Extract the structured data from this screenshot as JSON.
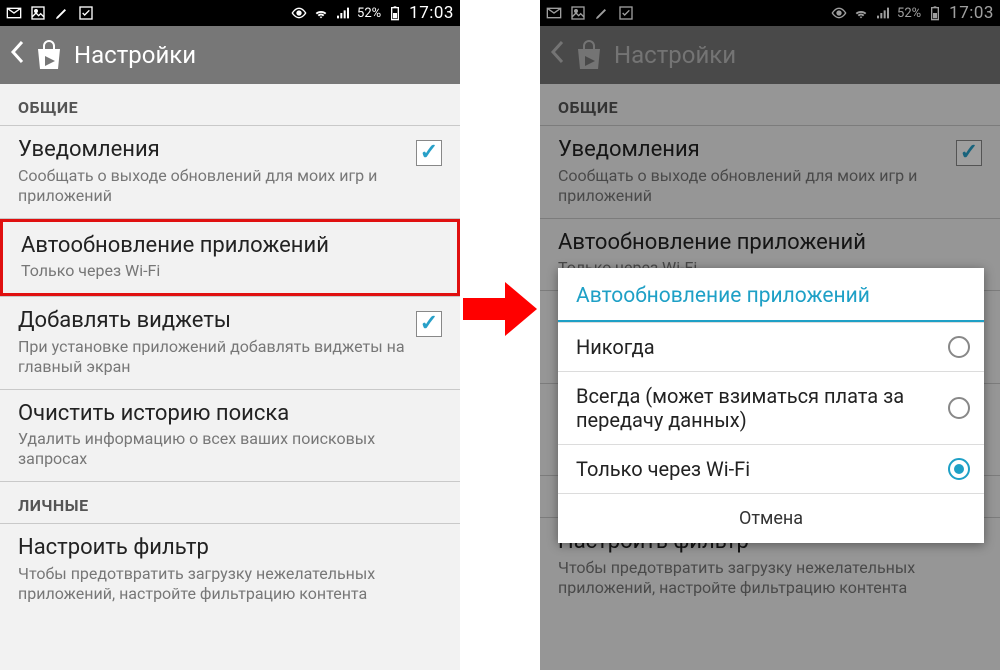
{
  "status": {
    "battery_percent": "52%",
    "time": "17:03"
  },
  "action_bar": {
    "title": "Настройки"
  },
  "sections": {
    "general": "ОБЩИЕ",
    "personal": "ЛИЧНЫЕ"
  },
  "settings": {
    "notifications": {
      "title": "Уведомления",
      "sub": "Сообщать о выходе обновлений для моих игр и приложений",
      "checked": true
    },
    "auto_update": {
      "title": "Автообновление приложений",
      "sub": "Только через Wi-Fi"
    },
    "add_widgets": {
      "title": "Добавлять виджеты",
      "sub": "При установке приложений добавлять виджеты на главный экран",
      "checked": true
    },
    "clear_history": {
      "title": "Очистить историю поиска",
      "sub": "Удалить информацию о всех ваших поисковых запросах"
    },
    "filter": {
      "title": "Настроить фильтр",
      "sub": "Чтобы предотвратить загрузку нежелательных приложений, настройте фильтрацию контента"
    }
  },
  "dialog": {
    "title": "Автообновление приложений",
    "options": {
      "never": "Никогда",
      "always": "Всегда (может взиматься плата за передачу данных)",
      "wifi": "Только через Wi-Fi"
    },
    "selected": "wifi",
    "cancel": "Отмена"
  }
}
